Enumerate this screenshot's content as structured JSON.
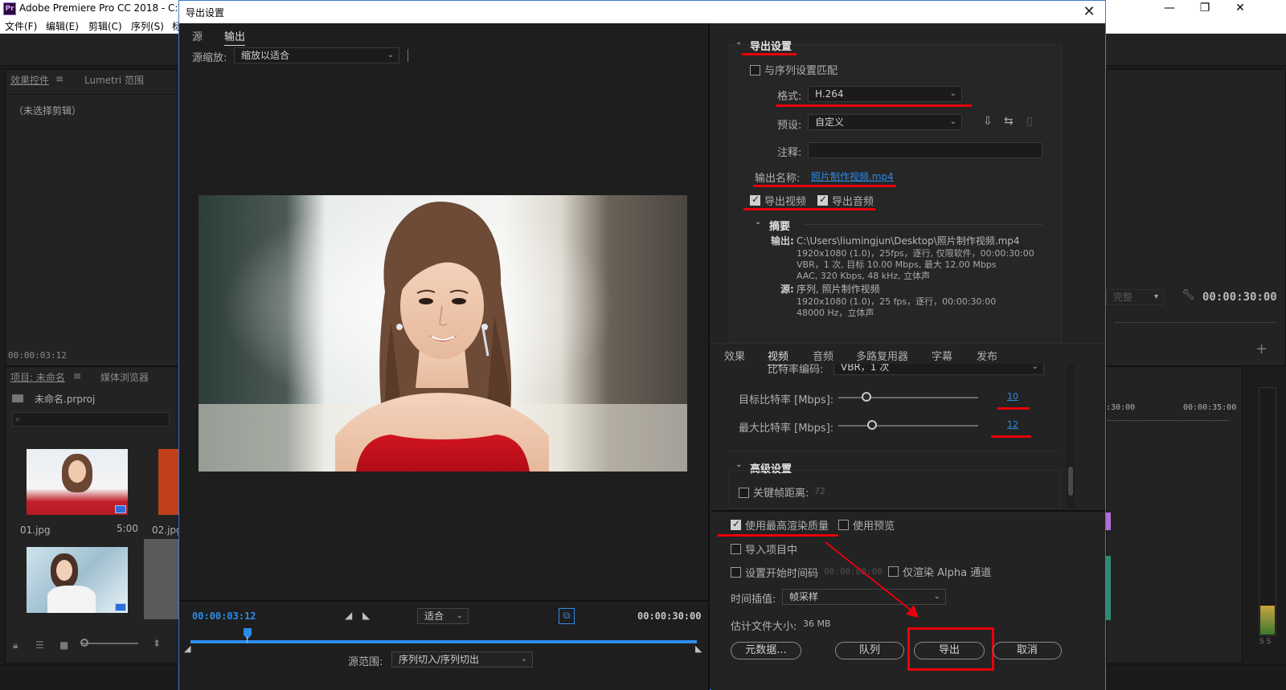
{
  "app": {
    "title": "Adobe Premiere Pro CC 2018 - C:\\",
    "logo_text": "Pr",
    "menu": [
      "文件(F)",
      "编辑(E)",
      "剪辑(C)",
      "序列(S)",
      "标"
    ],
    "window_controls": {
      "minimize": "—",
      "maximize": "❐",
      "close": "✕"
    }
  },
  "background_panels": {
    "effects_tab": "效果控件",
    "lumetri_tab": "Lumetri 范围",
    "other_tab": "源",
    "no_clip": "（未选择剪辑）",
    "timecode": "00:00:03:12",
    "project_tab": "项目: 未命名",
    "media_browser_tab": "媒体浏览器",
    "project_file": "未命名.prproj",
    "clips": [
      {
        "name": "01.jpg",
        "duration": "5:00"
      },
      {
        "name": "02.jpg",
        "duration": ""
      }
    ],
    "right_timecode": "00:00:30:00",
    "right_dropdown": "完整",
    "ruler_left": ":30:00",
    "ruler_right": "00:00:35:00",
    "plus": "+",
    "ss": "S S"
  },
  "dialog": {
    "title": "导出设置",
    "close_symbol": "✕",
    "preview": {
      "tabs": [
        "源",
        "输出"
      ],
      "active_tab": 1,
      "source_scale_label": "源缩放:",
      "source_scale_value": "缩放以适合",
      "current_time": "00:00:03:12",
      "fit_value": "适合",
      "end_time": "00:00:30:00",
      "source_range_label": "源范围:",
      "source_range_value": "序列切入/序列切出"
    },
    "export_settings": {
      "heading": "导出设置",
      "match_sequence_label": "与序列设置匹配",
      "format_label": "格式:",
      "format_value": "H.264",
      "preset_label": "预设:",
      "preset_value": "自定义",
      "comment_label": "注释:",
      "comment_value": "",
      "output_name_label": "输出名称:",
      "output_name_value": "照片制作视频.mp4",
      "export_video_label": "导出视频",
      "export_audio_label": "导出音频",
      "summary_heading": "摘要",
      "output_key": "输出:",
      "output_lines": [
        "C:\\Users\\liumingjun\\Desktop\\照片制作视频.mp4",
        "1920x1080 (1.0)，25fps，逐行, 仅限软件，00:00:30:00",
        "VBR，1 次, 目标 10.00 Mbps, 最大 12.00 Mbps",
        "AAC, 320 Kbps, 48  kHz, 立体声"
      ],
      "source_key": "源:",
      "source_lines": [
        "序列, 照片制作视频",
        "1920x1080 (1.0)，25 fps，逐行，00:00:30:00",
        "48000  Hz，立体声"
      ]
    },
    "settings_tabs": [
      "效果",
      "视频",
      "音频",
      "多路复用器",
      "字幕",
      "发布"
    ],
    "active_settings_tab": 1,
    "video": {
      "bitrate_encoding_label": "比特率编码:",
      "bitrate_encoding_value": "VBR，1 次",
      "target_bitrate_label": "目标比特率 [Mbps]:",
      "target_bitrate_value": "10",
      "target_bitrate_fraction": 0.2,
      "max_bitrate_label": "最大比特率 [Mbps]:",
      "max_bitrate_value": "12",
      "max_bitrate_fraction": 0.24
    },
    "advanced": {
      "heading": "高级设置",
      "keyframe_label": "关键帧距离:",
      "keyframe_value": "72"
    },
    "bottom": {
      "max_render_quality_label": "使用最高渲染质量",
      "use_previews_label": "使用预览",
      "import_project_label": "导入项目中",
      "set_start_tc_label": "设置开始时间码",
      "set_start_tc_value": "00:00:00:00",
      "render_alpha_label": "仅渲染 Alpha 通道",
      "time_interp_label": "时间插值:",
      "time_interp_value": "帧采样",
      "file_size_label": "估计文件大小:",
      "file_size_value": "36 MB",
      "metadata_button": "元数据...",
      "queue_button": "队列",
      "export_button": "导出",
      "cancel_button": "取消"
    }
  },
  "colors": {
    "accent_blue": "#2d8ceb",
    "annotation_red": "#e8000c",
    "panel_bg": "#232323"
  },
  "icons": {
    "dropdown": "chevron-down-icon",
    "preset_save": "save-preset-icon",
    "preset_import": "import-preset-icon",
    "preset_delete": "delete-preset-icon",
    "playhead": "playhead-icon",
    "in_point": "set-in-icon",
    "out_point": "set-out-icon",
    "crop": "crop-icon"
  }
}
